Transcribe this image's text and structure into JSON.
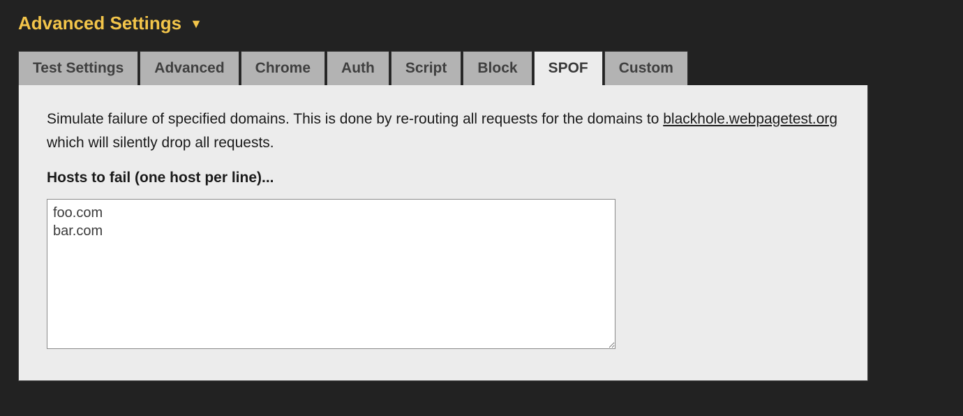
{
  "header": {
    "title": "Advanced Settings"
  },
  "tabs": {
    "items": [
      {
        "label": "Test Settings"
      },
      {
        "label": "Advanced"
      },
      {
        "label": "Chrome"
      },
      {
        "label": "Auth"
      },
      {
        "label": "Script"
      },
      {
        "label": "Block"
      },
      {
        "label": "SPOF"
      },
      {
        "label": "Custom"
      }
    ]
  },
  "panel": {
    "desc_prefix": "Simulate failure of specified domains. This is done by re-routing all requests for the domains to ",
    "desc_link": "blackhole.webpagetest.org",
    "desc_suffix": " which will silently drop all requests.",
    "hosts_label": "Hosts to fail (one host per line)...",
    "hosts_value": "foo.com\nbar.com"
  }
}
